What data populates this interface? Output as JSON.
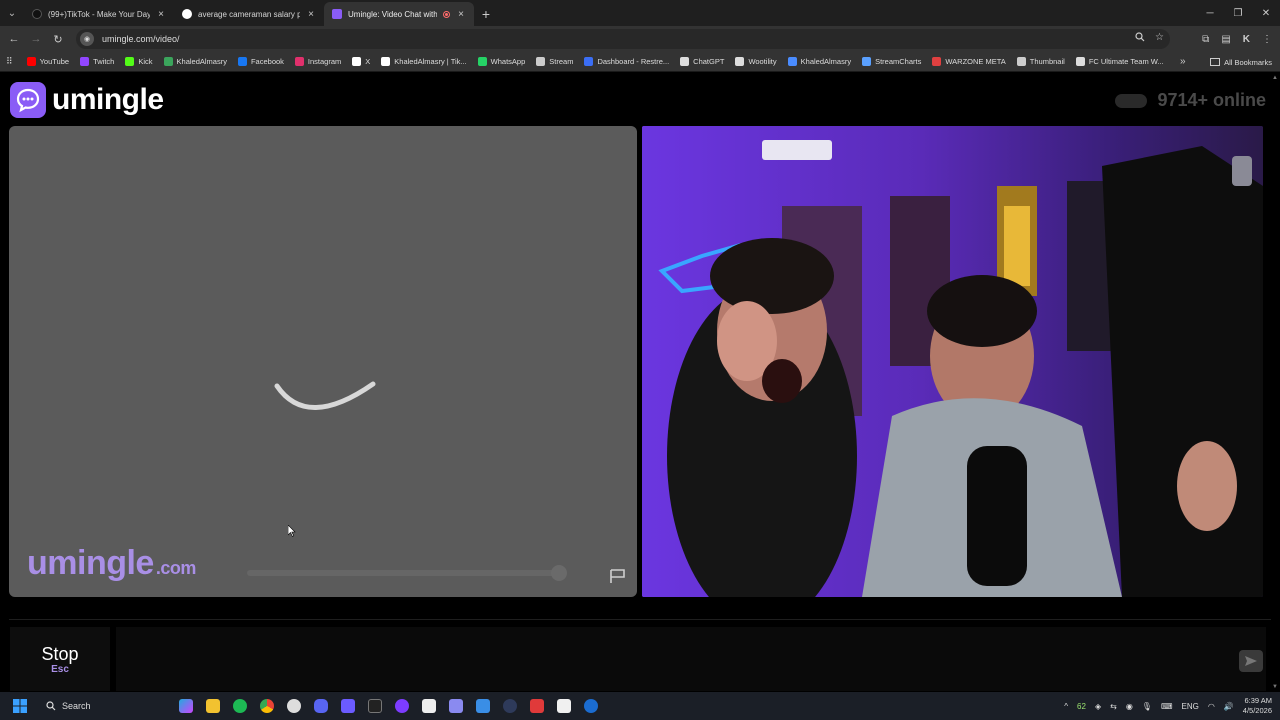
{
  "browser": {
    "tabs": [
      {
        "title": "(99+)TikTok - Make Your Day",
        "color": "#111111",
        "active": false
      },
      {
        "title": "average cameraman salary per",
        "color": "#4285f4",
        "active": false
      },
      {
        "title": "Umingle: Video Chat with S",
        "color": "#8a5cf6",
        "active": true
      }
    ],
    "url": "umingle.com/video/",
    "bookmarks": [
      {
        "label": "YouTube",
        "color": "#ff0000"
      },
      {
        "label": "Twitch",
        "color": "#9146ff"
      },
      {
        "label": "Kick",
        "color": "#53fc18"
      },
      {
        "label": "KhaledAlmasry",
        "color": "#3ba55c"
      },
      {
        "label": "Facebook",
        "color": "#1877f2"
      },
      {
        "label": "Instagram",
        "color": "#e1306c"
      },
      {
        "label": "X",
        "color": "#ffffff"
      },
      {
        "label": "KhaledAlmasry | Tik...",
        "color": "#ffffff"
      },
      {
        "label": "WhatsApp",
        "color": "#25d366"
      },
      {
        "label": "Stream",
        "color": "#cccccc"
      },
      {
        "label": "Dashboard - Restre...",
        "color": "#3b6ef5"
      },
      {
        "label": "ChatGPT",
        "color": "#dddddd"
      },
      {
        "label": "Wootility",
        "color": "#dddddd"
      },
      {
        "label": "KhaledAlmasry",
        "color": "#4a8cff"
      },
      {
        "label": "StreamCharts",
        "color": "#5aa0ff"
      },
      {
        "label": "WARZONE META",
        "color": "#e04040"
      },
      {
        "label": "Thumbnail",
        "color": "#cccccc"
      },
      {
        "label": "FC Ultimate Team W...",
        "color": "#dddddd"
      }
    ],
    "all_bookmarks": "All Bookmarks"
  },
  "site": {
    "logo_text": "umingle",
    "online_count": "9714+ online",
    "watermark_name": "umingle",
    "watermark_tld": ".com",
    "stop_label": "Stop",
    "stop_key": "Esc",
    "accent_color": "#8a5cf6"
  },
  "taskbar": {
    "search_label": "Search",
    "battery_badge": "62",
    "language": "ENG",
    "time": "6:39 AM",
    "date": "4/5/2026"
  }
}
